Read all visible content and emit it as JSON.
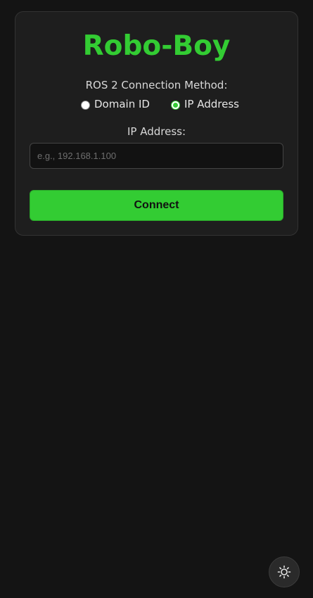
{
  "app": {
    "title": "Robo-Boy"
  },
  "connection": {
    "method_label": "ROS 2 Connection Method:",
    "options": [
      {
        "label": "Domain ID",
        "selected": false
      },
      {
        "label": "IP Address",
        "selected": true
      }
    ]
  },
  "ip": {
    "label": "IP Address:",
    "placeholder": "e.g., 192.168.1.100",
    "value": ""
  },
  "actions": {
    "connect_label": "Connect"
  },
  "theme_toggle": {
    "icon": "sun-icon"
  },
  "colors": {
    "accent": "#33cc33",
    "background": "#141414",
    "card": "#1e1e1e"
  }
}
